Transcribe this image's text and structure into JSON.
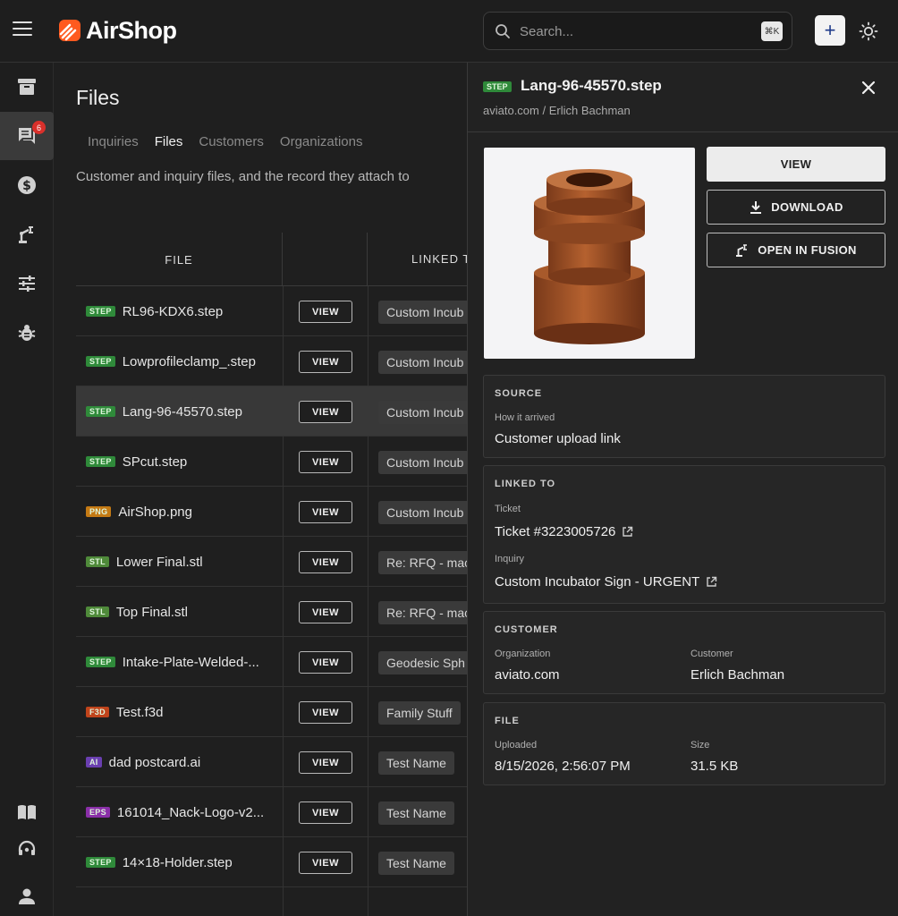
{
  "app": {
    "name": "AirShop",
    "brand_color": "#ff5a1f"
  },
  "search": {
    "placeholder": "Search...",
    "shortcut": "⌘K"
  },
  "topbar": {
    "add_label": "+"
  },
  "sidebar": {
    "badge_count": "6",
    "items": [
      {
        "icon": "archive-icon"
      },
      {
        "icon": "chat-icon"
      },
      {
        "icon": "dollar-icon"
      },
      {
        "icon": "robot-arm-icon"
      },
      {
        "icon": "sliders-icon"
      },
      {
        "icon": "bug-icon"
      },
      {
        "icon": "book-icon"
      },
      {
        "icon": "support-icon"
      },
      {
        "icon": "user-icon"
      }
    ]
  },
  "page": {
    "title": "Files",
    "tabs": [
      "Inquiries",
      "Files",
      "Customers",
      "Organizations"
    ],
    "active_tab": "Files",
    "subtitle": "Customer and inquiry files, and the record they attach to"
  },
  "table": {
    "columns": {
      "file": "FILE",
      "linked": "LINKED T"
    },
    "view_label": "VIEW",
    "rows": [
      {
        "type": "STEP",
        "color": "#2f8a3a",
        "name": "RL96-KDX6.step",
        "linked": "Custom Incub"
      },
      {
        "type": "STEP",
        "color": "#2f8a3a",
        "name": "Lowprofileclamp_.step",
        "linked": "Custom Incub"
      },
      {
        "type": "STEP",
        "color": "#2f8a3a",
        "name": "Lang-96-45570.step",
        "linked": "Custom Incub"
      },
      {
        "type": "STEP",
        "color": "#2f8a3a",
        "name": "SPcut.step",
        "linked": "Custom Incub"
      },
      {
        "type": "PNG",
        "color": "#c47a14",
        "name": "AirShop.png",
        "linked": "Custom Incub"
      },
      {
        "type": "STL",
        "color": "#4f8a3a",
        "name": "Lower Final.stl",
        "linked": "Re: RFQ - mac"
      },
      {
        "type": "STL",
        "color": "#4f8a3a",
        "name": "Top Final.stl",
        "linked": "Re: RFQ - mac"
      },
      {
        "type": "STEP",
        "color": "#2f8a3a",
        "name": "Intake-Plate-Welded-...",
        "linked": "Geodesic Sph"
      },
      {
        "type": "F3D",
        "color": "#c0441b",
        "name": "Test.f3d",
        "linked": "Family Stuff"
      },
      {
        "type": "AI",
        "color": "#6a3fb0",
        "name": "dad postcard.ai",
        "linked": "Test Name"
      },
      {
        "type": "EPS",
        "color": "#8a2fa8",
        "name": "161014_Nack-Logo-v2...",
        "linked": "Test Name"
      },
      {
        "type": "STEP",
        "color": "#2f8a3a",
        "name": "14×18-Holder.step",
        "linked": "Test Name"
      }
    ]
  },
  "drawer": {
    "badge": "STEP",
    "title": "Lang-96-45570.step",
    "subtitle": "aviato.com / Erlich Bachman",
    "buttons": {
      "view": "VIEW",
      "download": "DOWNLOAD",
      "fusion": "OPEN IN FUSION"
    },
    "source": {
      "heading": "SOURCE",
      "label": "How it arrived",
      "value": "Customer upload link"
    },
    "linked": {
      "heading": "LINKED TO",
      "ticket_label": "Ticket",
      "ticket_value": "Ticket #3223005726",
      "inquiry_label": "Inquiry",
      "inquiry_value": "Custom Incubator Sign - URGENT"
    },
    "customer": {
      "heading": "CUSTOMER",
      "org_label": "Organization",
      "org_value": "aviato.com",
      "cust_label": "Customer",
      "cust_value": "Erlich Bachman"
    },
    "file": {
      "heading": "FILE",
      "uploaded_label": "Uploaded",
      "uploaded_value": "8/15/2026, 2:56:07 PM",
      "size_label": "Size",
      "size_value": "31.5 KB"
    }
  }
}
